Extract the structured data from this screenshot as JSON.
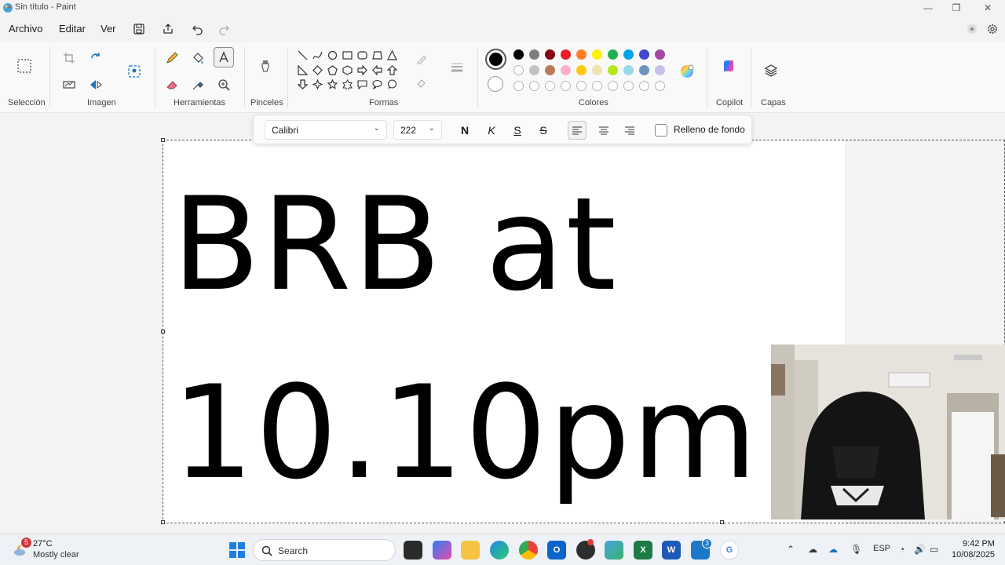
{
  "window": {
    "title": "Sin título - Paint",
    "controls": [
      "minimize-icon",
      "maximize-icon",
      "close-icon"
    ]
  },
  "menu": {
    "items": [
      "Archivo",
      "Editar",
      "Ver"
    ],
    "quick_actions": [
      "save-icon",
      "share-icon",
      "undo-icon",
      "redo-icon"
    ]
  },
  "ribbon": {
    "groups": {
      "seleccion": "Selección",
      "imagen": "Imagen",
      "herramientas": "Herramientas",
      "pinceles": "Pinceles",
      "formas": "Formas",
      "colores": "Colores",
      "copilot": "Copilot",
      "capas": "Capas"
    },
    "colors": {
      "primary": "#000000",
      "secondary": "#ffffff",
      "palette_row1": [
        "#000000",
        "#7f7f7f",
        "#880015",
        "#ed1c24",
        "#ff7f27",
        "#fff200",
        "#22b14c",
        "#00a2e8",
        "#3f48cc",
        "#a349a4"
      ],
      "palette_row2": [
        "#ffffff",
        "#c3c3c3",
        "#b97a57",
        "#ffaec9",
        "#ffc90e",
        "#efe4b0",
        "#b5e61d",
        "#99d9ea",
        "#7092be",
        "#c8bfe7"
      ],
      "palette_row3_empty": 10
    }
  },
  "text_toolbar": {
    "font": "Calibri",
    "size": "222",
    "bold": "N",
    "italic": "K",
    "underline": "S",
    "strike": "S",
    "fill_label": "Relleno de fondo"
  },
  "canvas": {
    "line1": "BRB at",
    "line2": "10.10pm"
  },
  "taskbar": {
    "weather_badge": "5",
    "temperature": "27°C",
    "weather": "Mostly clear",
    "search": "Search",
    "teams_badge": "3",
    "lang": "ESP",
    "time": "9:42 PM",
    "date": "10/08/2025"
  }
}
